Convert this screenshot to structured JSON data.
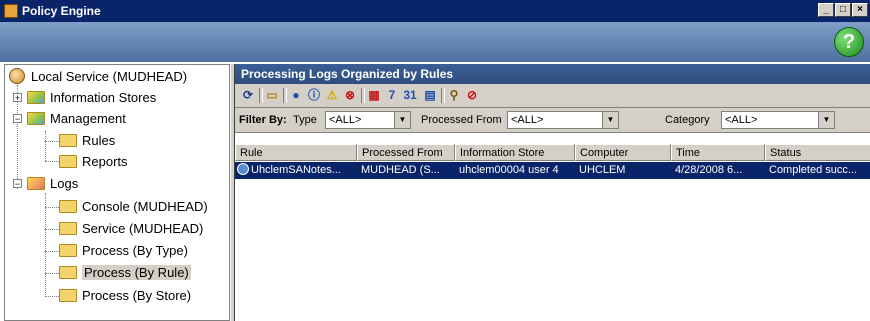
{
  "window": {
    "title": "Policy Engine",
    "minimize": "_",
    "maximize": "□",
    "close": "×"
  },
  "help": {
    "label": "?"
  },
  "tree": {
    "root": "Local Service (MUDHEAD)",
    "information_stores": "Information Stores",
    "management": "Management",
    "rules": "Rules",
    "reports": "Reports",
    "logs": "Logs",
    "console": "Console (MUDHEAD)",
    "service": "Service (MUDHEAD)",
    "process_by_type": "Process (By Type)",
    "process_by_rule": "Process (By Rule)",
    "process_by_store": "Process (By Store)"
  },
  "pane": {
    "title": "Processing Logs Organized by Rules",
    "toolbar": [
      "refresh",
      "open-folder",
      "info-blue",
      "info-outline",
      "warning",
      "error",
      "calendar-7",
      "calendar-7b",
      "calendar-31",
      "calendar-all",
      "search",
      "search-stop"
    ],
    "filter": {
      "label": "Filter By:",
      "type_label": "Type",
      "type_value": "<ALL>",
      "processed_from_label": "Processed From",
      "processed_from_value": "<ALL>",
      "category_label": "Category",
      "category_value": "<ALL>"
    },
    "columns": [
      "Rule",
      "Processed From",
      "Information Store",
      "Computer",
      "Time",
      "Status"
    ],
    "rows": [
      [
        "UhclemSANotes...",
        "MUDHEAD (S...",
        "uhclem00004 user 4",
        "UHCLEM",
        "4/28/2008 6...",
        "Completed succ..."
      ]
    ]
  }
}
